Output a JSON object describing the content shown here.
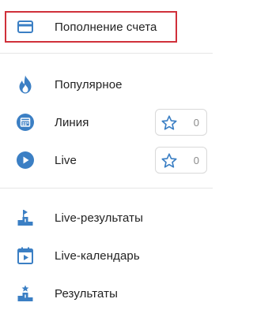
{
  "menu": {
    "topup": {
      "label": "Пополнение счета",
      "icon": "card-icon"
    },
    "popular": {
      "label": "Популярное",
      "icon": "flame-icon"
    },
    "line": {
      "label": "Линия",
      "icon": "calendar-grid-icon",
      "favorites": "0"
    },
    "live": {
      "label": "Live",
      "icon": "play-circle-icon",
      "favorites": "0"
    },
    "live_results": {
      "label": "Live-результаты",
      "icon": "podium-icon"
    },
    "live_calendar": {
      "label": "Live-календарь",
      "icon": "calendar-play-icon"
    },
    "results": {
      "label": "Результаты",
      "icon": "podium-star-icon"
    }
  },
  "colors": {
    "icon": "#3b7fc4",
    "highlight_border": "#d0303a",
    "star": "#3b7fc4",
    "divider": "#e6e6e6"
  }
}
